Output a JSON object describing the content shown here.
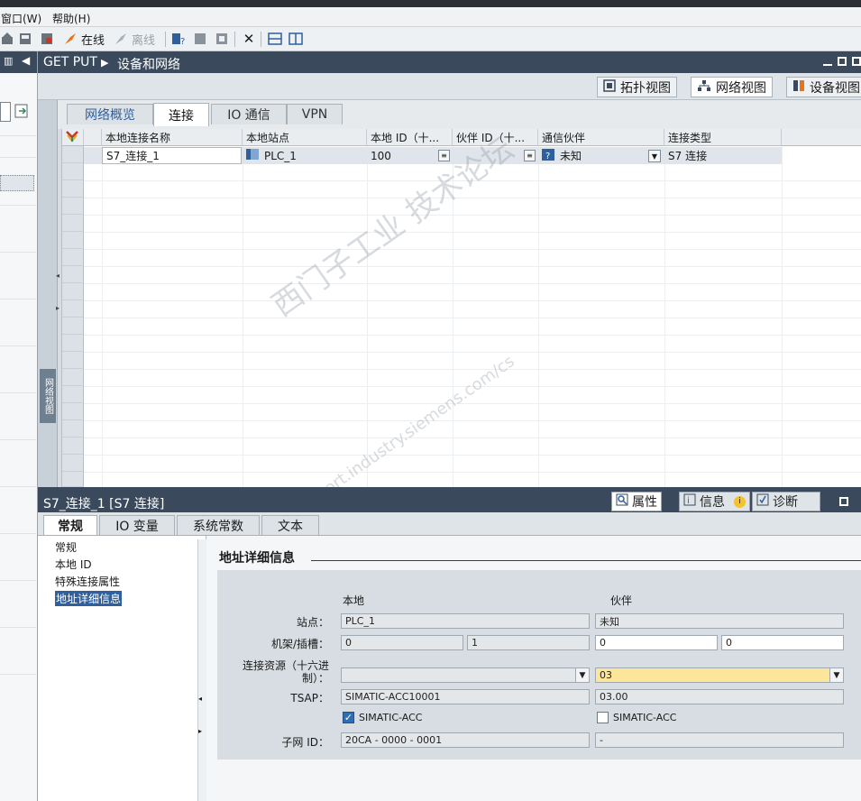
{
  "menu": {
    "window": "窗口(W)",
    "help": "帮助(H)"
  },
  "toolbar": {
    "online": "在线",
    "offline": "离线"
  },
  "breadcrumb": {
    "project": "GET PUT",
    "page": "设备和网络"
  },
  "view_tabs": {
    "topology": "拓扑视图",
    "network": "网络视图",
    "device": "设备视图"
  },
  "side_label": "网络视图",
  "inner_tabs": [
    "网络概览",
    "连接",
    "IO 通信",
    "VPN"
  ],
  "grid": {
    "headers": [
      "本地连接名称",
      "本地站点",
      "本地 ID（十...",
      "伙伴 ID（十...",
      "通信伙伴",
      "连接类型"
    ],
    "row": {
      "name": "S7_连接_1",
      "station": "PLC_1",
      "local_id": "100",
      "partner_id": "",
      "partner": "未知",
      "type": "S7 连接"
    }
  },
  "inspector": {
    "title": "S7_连接_1 [S7 连接]",
    "panel_tabs": {
      "properties": "属性",
      "info": "信息",
      "diagnostics": "诊断"
    },
    "tabs": [
      "常规",
      "IO 变量",
      "系统常数",
      "文本"
    ],
    "nav": [
      "常规",
      "本地 ID",
      "特殊连接属性",
      "地址详细信息"
    ],
    "section_title": "地址详细信息",
    "local_label": "本地",
    "partner_label": "伙伴",
    "station_label": "站点：",
    "rack_label": "机架/插槽：",
    "resource_label1": "连接资源（十六进",
    "resource_label2": "制）：",
    "tsap_label": "TSAP：",
    "subnet_label": "子网 ID：",
    "local": {
      "station": "PLC_1",
      "rack": "0",
      "slot": "1",
      "resource": "",
      "tsap": "SIMATIC-ACC10001",
      "simatic": "SIMATIC-ACC",
      "subnet": "20CA - 0000 - 0001"
    },
    "partner": {
      "station": "未知",
      "rack": "0",
      "slot": "0",
      "resource": "03",
      "tsap": "03.00",
      "simatic": "SIMATIC-ACC",
      "subnet": "-"
    }
  },
  "watermark": {
    "line1": "西门子工业  技术论坛",
    "line2": "support.industry.siemens.com/cs"
  }
}
